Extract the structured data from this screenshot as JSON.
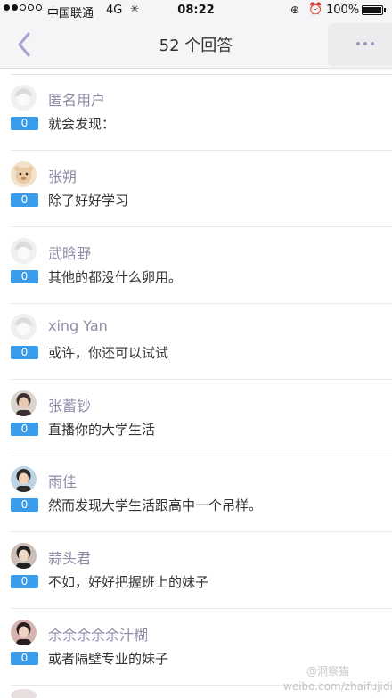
{
  "status_bar": {
    "carrier": "中国联通",
    "network": "4G",
    "activity": "✳",
    "time": "08:22",
    "battery": "100%",
    "battery_level": 1.0
  },
  "nav": {
    "title": "52 个回答",
    "accent_color": "#a9a4d6"
  },
  "answers": [
    {
      "user": "匿名用户",
      "votes": "0",
      "text": "就会发现：",
      "avatar": "placeholder"
    },
    {
      "user": "张朔",
      "votes": "0",
      "text": "除了好好学习",
      "avatar": "bear"
    },
    {
      "user": "武晗野",
      "votes": "0",
      "text": "其他的都没什么卵用。",
      "avatar": "placeholder"
    },
    {
      "user": "xing Yan",
      "votes": "0",
      "text": "或许，你还可以试试",
      "avatar": "placeholder"
    },
    {
      "user": "张蓄钞",
      "votes": "0",
      "text": "直播你的大学生活",
      "avatar": "photo"
    },
    {
      "user": "雨佳",
      "votes": "0",
      "text": "然而发现大学生活跟高中一个吊样。",
      "avatar": "photo"
    },
    {
      "user": "蒜头君",
      "votes": "0",
      "text": "不如，好好把握班上的妹子",
      "avatar": "photo"
    },
    {
      "user": "余余余余余汁糊",
      "votes": "0",
      "text": "或者隔壁专业的妹子",
      "avatar": "photo"
    }
  ],
  "watermark": {
    "logo_text": "@洞察猫",
    "url": "weibo.com/zhaifujidi"
  },
  "colors": {
    "badge": "#3a9be8",
    "username": "#8d8ba8"
  }
}
